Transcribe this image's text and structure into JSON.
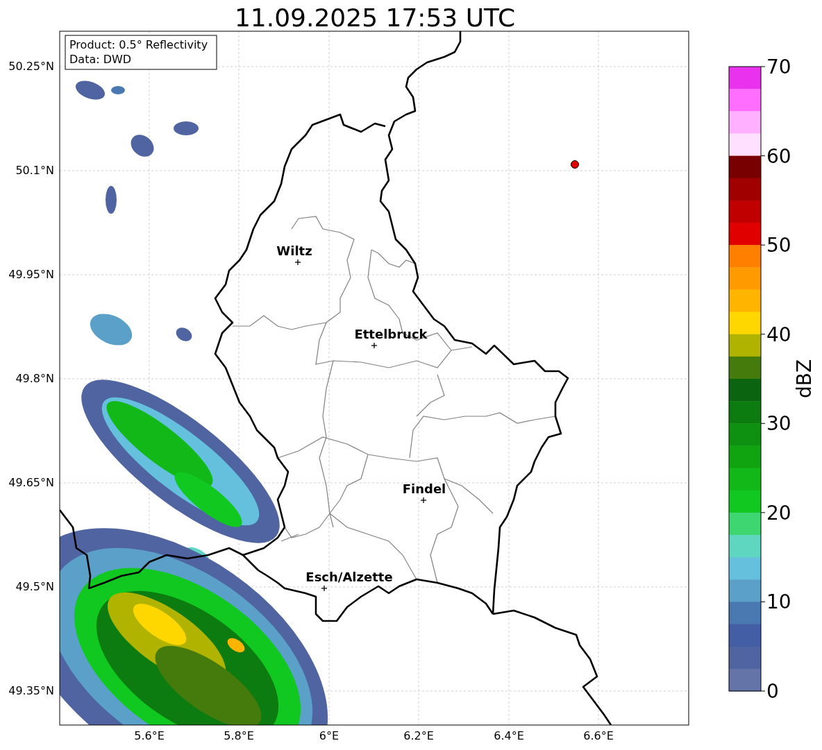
{
  "title": "11.09.2025 17:53 UTC",
  "info_box": {
    "lines": [
      "Product: 0.5° Reflectivity",
      "Data: DWD"
    ]
  },
  "map": {
    "lat_ticks": [
      "50.25°N",
      "50.1°N",
      "49.95°N",
      "49.8°N",
      "49.65°N",
      "49.5°N",
      "49.35°N"
    ],
    "lon_ticks": [
      "5.6°E",
      "5.8°E",
      "6°E",
      "6.2°E",
      "6.4°E",
      "6.6°E"
    ],
    "cities": [
      {
        "name": "Wiltz"
      },
      {
        "name": "Ettelbruck"
      },
      {
        "name": "Findel"
      },
      {
        "name": "Esch/Alzette"
      }
    ]
  },
  "colorbar": {
    "label": "dBZ",
    "ticks": [
      "70",
      "60",
      "50",
      "40",
      "30",
      "20",
      "10",
      "0"
    ],
    "segments": [
      {
        "color": "#e832ee"
      },
      {
        "color": "#ff6eff"
      },
      {
        "color": "#ffb0ff"
      },
      {
        "color": "#ffe0ff"
      },
      {
        "color": "#780000"
      },
      {
        "color": "#a00000"
      },
      {
        "color": "#c00000"
      },
      {
        "color": "#e00000"
      },
      {
        "color": "#ff7f00"
      },
      {
        "color": "#ff9a00"
      },
      {
        "color": "#ffb400"
      },
      {
        "color": "#ffd700"
      },
      {
        "color": "#b0b400"
      },
      {
        "color": "#457a0c"
      },
      {
        "color": "#0a6410"
      },
      {
        "color": "#0c7c10"
      },
      {
        "color": "#0e9010"
      },
      {
        "color": "#10a510"
      },
      {
        "color": "#12b818"
      },
      {
        "color": "#10c820"
      },
      {
        "color": "#3ed670"
      },
      {
        "color": "#5fd6c0"
      },
      {
        "color": "#64c0dc"
      },
      {
        "color": "#5aa0c8"
      },
      {
        "color": "#4a78b0"
      },
      {
        "color": "#435ea4"
      },
      {
        "color": "#4f64a0"
      },
      {
        "color": "#6473a8"
      }
    ]
  }
}
